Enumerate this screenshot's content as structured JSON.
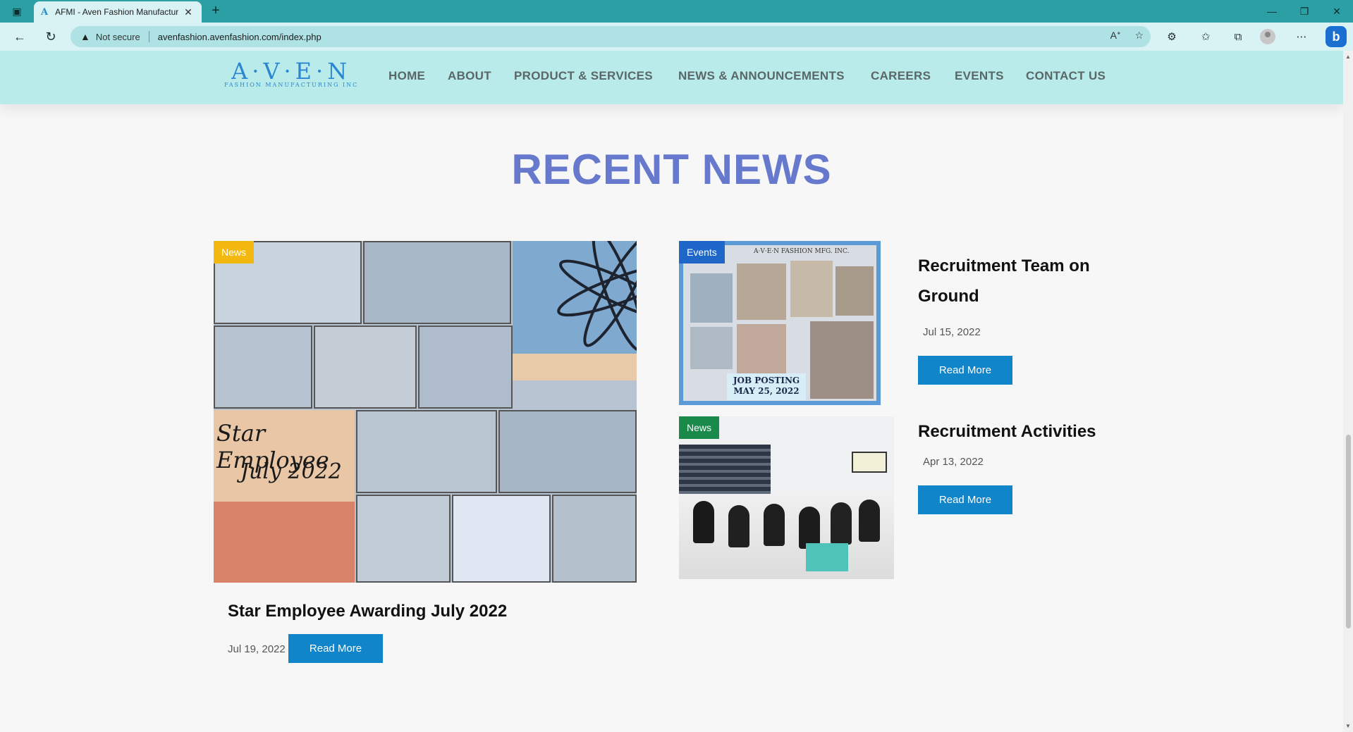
{
  "browser": {
    "tab_title": "AFMI - Aven Fashion Manufactur",
    "not_secure": "Not secure",
    "url": "avenfashion.avenfashion.com/index.php"
  },
  "site": {
    "logo_main": "A·V·E·N",
    "logo_sub": "FASHION MANUFACTURING INC",
    "nav": [
      "HOME",
      "ABOUT",
      "PRODUCT & SERVICES",
      "NEWS & ANNOUNCEMENTS",
      "CAREERS",
      "EVENTS",
      "CONTACT US"
    ]
  },
  "section": {
    "title": "RECENT NEWS"
  },
  "featured": {
    "badge": "News",
    "overlay_line1": "Star Employee",
    "overlay_line2": "July 2022",
    "title": "Star Employee Awarding July 2022",
    "date": "Jul 19, 2022",
    "button": "Read More"
  },
  "side_posts": [
    {
      "badge": "Events",
      "image_text_top": "A·V·E·N FASHION MFG. INC.",
      "image_text_bottom1": "JOB POSTING",
      "image_text_bottom2": "MAY 25, 2022",
      "title": "Recruitment Team on Ground",
      "date": "Jul 15, 2022",
      "button": "Read More"
    },
    {
      "badge": "News",
      "title": "Recruitment Activities",
      "date": "Apr 13, 2022",
      "button": "Read More"
    }
  ]
}
